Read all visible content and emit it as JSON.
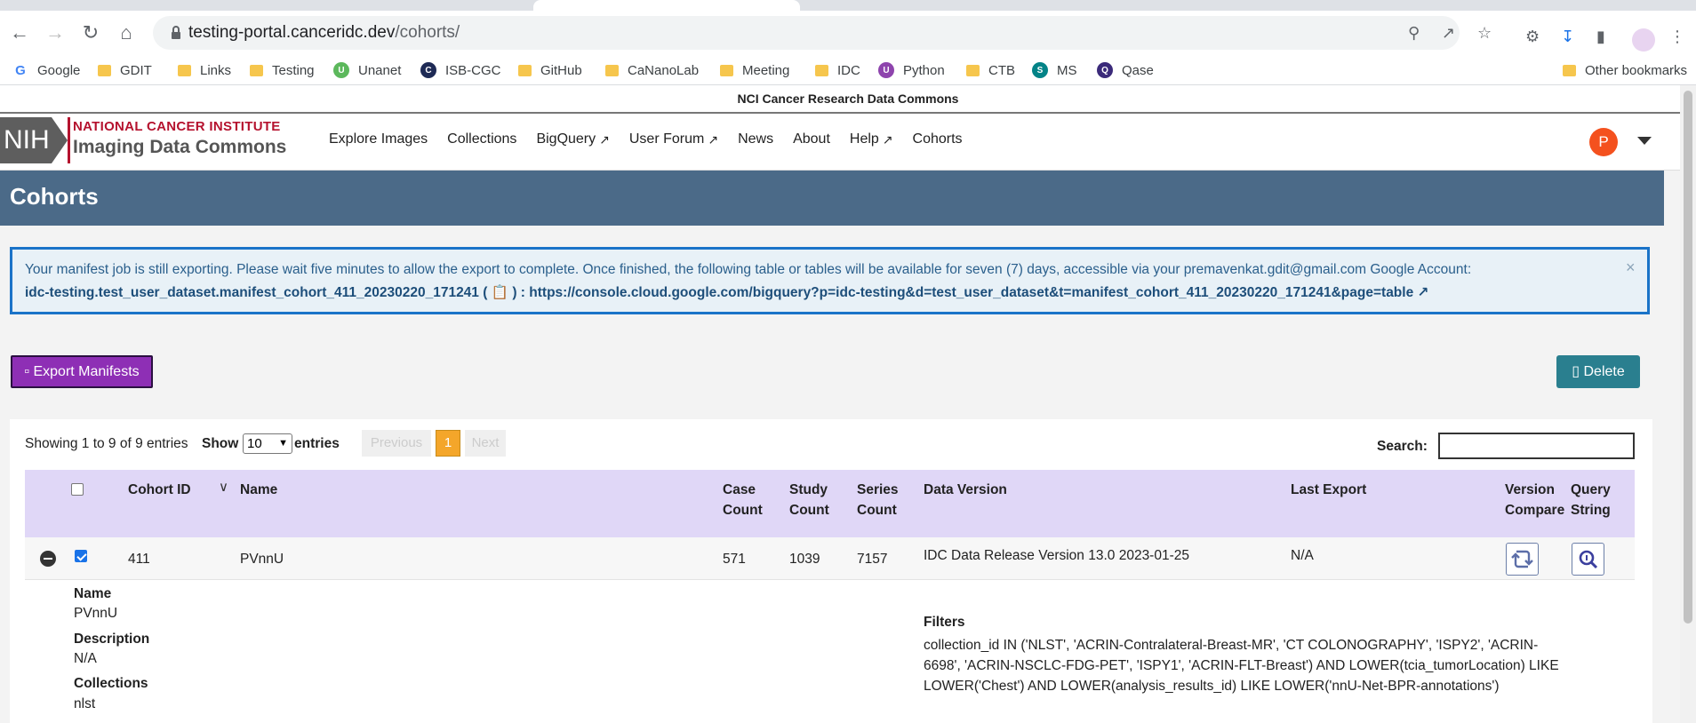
{
  "browser": {
    "url_domain": "testing-portal.canceridc.dev",
    "url_path": "/cohorts/",
    "bookmarks": [
      {
        "label": "Google",
        "icon": "google-icon"
      },
      {
        "label": "GDIT",
        "icon": "folder-icon"
      },
      {
        "label": "Links",
        "icon": "folder-icon"
      },
      {
        "label": "Testing",
        "icon": "folder-icon"
      },
      {
        "label": "Unanet",
        "icon": "unanet-icon"
      },
      {
        "label": "ISB-CGC",
        "icon": "isb-cgc-icon"
      },
      {
        "label": "GitHub",
        "icon": "folder-icon"
      },
      {
        "label": "CaNanoLab",
        "icon": "folder-icon"
      },
      {
        "label": "Meeting",
        "icon": "folder-icon"
      },
      {
        "label": "IDC",
        "icon": "folder-icon"
      },
      {
        "label": "Python",
        "icon": "python-icon"
      },
      {
        "label": "CTB",
        "icon": "folder-icon"
      },
      {
        "label": "MS",
        "icon": "sharepoint-icon"
      },
      {
        "label": "Qase",
        "icon": "qase-icon"
      }
    ],
    "other_bookmarks": "Other bookmarks"
  },
  "banner": "NCI Cancer Research Data Commons",
  "header": {
    "logo_nih": "NIH",
    "logo_line1": "NATIONAL CANCER INSTITUTE",
    "logo_line2": "Imaging Data Commons",
    "nav": [
      {
        "label": "Explore Images",
        "external": false
      },
      {
        "label": "Collections",
        "external": false
      },
      {
        "label": "BigQuery",
        "external": true
      },
      {
        "label": "User Forum",
        "external": true
      },
      {
        "label": "News",
        "external": false
      },
      {
        "label": "About",
        "external": false
      },
      {
        "label": "Help",
        "external": true
      },
      {
        "label": "Cohorts",
        "external": false
      }
    ],
    "avatar_letter": "P"
  },
  "page_title": "Cohorts",
  "alert": {
    "message": "Your manifest job is still exporting. Please wait five minutes to allow the export to complete. Once finished, the following table or tables will be available for seven (7) days, accessible via your premavenkat.gdit@gmail.com Google Account:",
    "table_name": "idc-testing.test_user_dataset.manifest_cohort_411_20230220_171241",
    "separator": ":",
    "link": "https://console.cloud.google.com/bigquery?p=idc-testing&d=test_user_dataset&t=manifest_cohort_411_20230220_171241&page=table",
    "close": "×"
  },
  "buttons": {
    "export": "Export Manifests",
    "delete": "Delete"
  },
  "table_controls": {
    "showing": "Showing 1 to 9 of 9 entries",
    "show_label": "Show",
    "page_size": "10",
    "entries_label": "entries",
    "prev": "Previous",
    "page": "1",
    "next": "Next",
    "search_label": "Search:",
    "search_value": ""
  },
  "columns": {
    "cohort_id": "Cohort ID",
    "name": "Name",
    "case_count_1": "Case",
    "case_count_2": "Count",
    "study_count_1": "Study",
    "study_count_2": "Count",
    "series_count_1": "Series",
    "series_count_2": "Count",
    "data_version": "Data Version",
    "last_export": "Last Export",
    "version_compare_1": "Version",
    "version_compare_2": "Compare",
    "query_string_1": "Query",
    "query_string_2": "String"
  },
  "row": {
    "cohort_id": "411",
    "name": "PVnnU",
    "case_count": "571",
    "study_count": "1039",
    "series_count": "7157",
    "data_version": "IDC Data Release Version 13.0 2023-01-25",
    "last_export": "N/A"
  },
  "details": {
    "name_label": "Name",
    "name_value": "PVnnU",
    "description_label": "Description",
    "description_value": "N/A",
    "collections_label": "Collections",
    "collections_value": "nlst",
    "filters_label": "Filters",
    "filters_value": "collection_id IN ('NLST', 'ACRIN-Contralateral-Breast-MR', 'CT COLONOGRAPHY', 'ISPY2', 'ACRIN-6698', 'ACRIN-NSCLC-FDG-PET', 'ISPY1', 'ACRIN-FLT-Breast') AND LOWER(tcia_tumorLocation) LIKE LOWER('Chest') AND LOWER(analysis_results_id) LIKE LOWER('nnU-Net-BPR-annotations')"
  }
}
